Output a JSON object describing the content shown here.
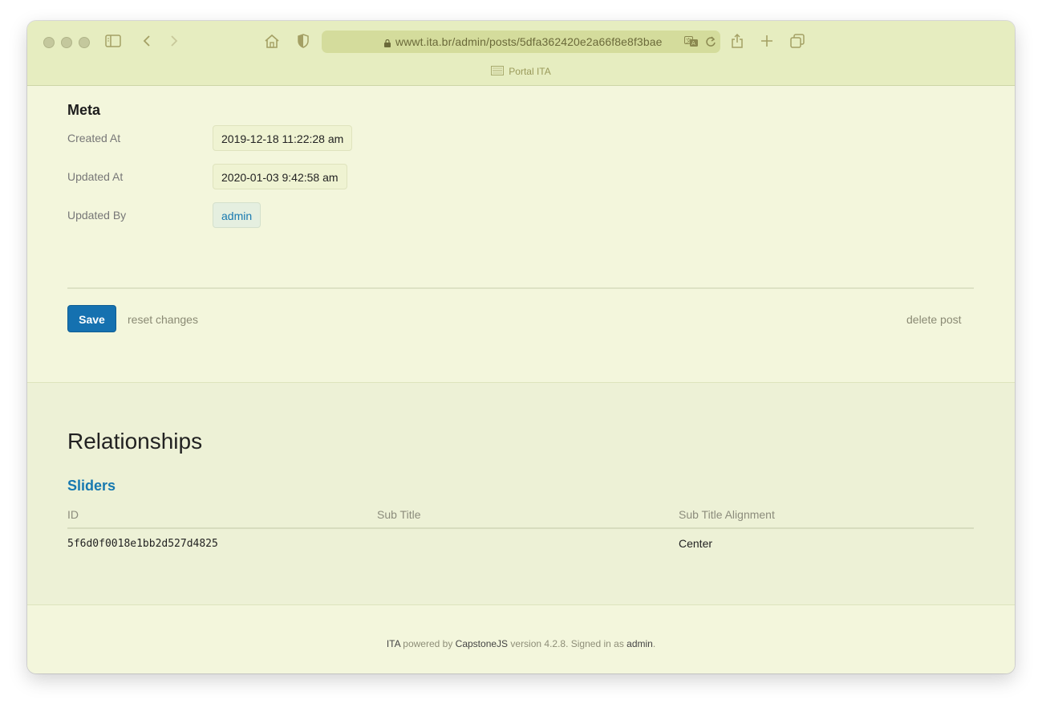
{
  "browser": {
    "url": "wwwt.ita.br/admin/posts/5dfa362420e2a66f8e8f3bae",
    "tab_title": "Portal ITA",
    "icons": [
      "sidebar-icon",
      "back-icon",
      "forward-icon",
      "home-icon",
      "shield-icon",
      "lock-icon",
      "translate-icon",
      "reload-icon",
      "share-icon",
      "new-tab-icon",
      "tabs-overview-icon"
    ]
  },
  "meta": {
    "title": "Meta",
    "fields": [
      {
        "label": "Created At",
        "value": "2019-12-18 11:22:28 am"
      },
      {
        "label": "Updated At",
        "value": "2020-01-03 9:42:58 am"
      },
      {
        "label": "Updated By",
        "value": "admin"
      }
    ]
  },
  "actions": {
    "save": "Save",
    "reset": "reset changes",
    "delete": "delete post"
  },
  "relationships": {
    "title": "Relationships",
    "sliders": {
      "title": "Sliders",
      "columns": [
        "ID",
        "Sub Title",
        "Sub Title Alignment"
      ],
      "rows": [
        {
          "id": "5f6d0f0018e1bb2d527d4825",
          "sub_title": "",
          "alignment": "Center"
        }
      ]
    }
  },
  "footer": {
    "brand": "ITA",
    "powered_by": "powered by",
    "framework": "CapstoneJS",
    "version_text": "version 4.2.8. Signed in as",
    "user": "admin",
    "end": "."
  },
  "colors": {
    "accent": "#1571b0",
    "link": "#1779b0",
    "toolbar": "#e6edc0",
    "background": "#f3f6dc"
  }
}
